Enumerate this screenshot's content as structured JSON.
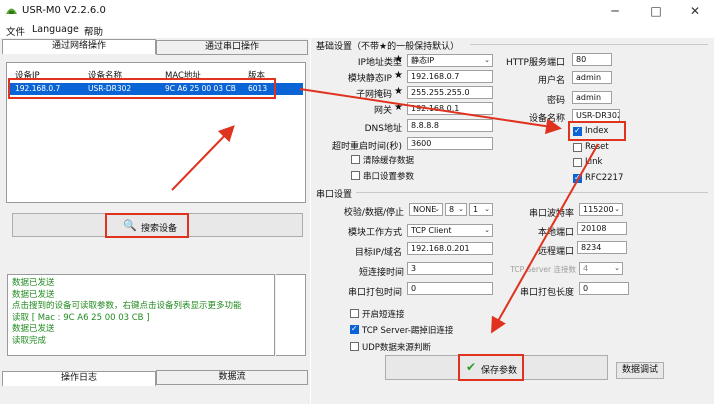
{
  "window": {
    "title": "USR-M0 V2.2.6.0"
  },
  "menu": [
    "文件",
    "Language",
    "帮助"
  ],
  "left_tabs": [
    "通过网络操作",
    "通过串口操作"
  ],
  "device_list": {
    "headers": [
      "设备IP",
      "设备名称",
      "MAC地址",
      "版本"
    ],
    "rows": [
      {
        "ip": "192.168.0.7",
        "name": "USR-DR302",
        "mac": "9C A6 25 00 03 CB",
        "version": "6013"
      }
    ]
  },
  "search_button": "搜索设备",
  "log": {
    "lines": [
      "数据已发送",
      "数据已发送",
      "点击搜到的设备可读取参数，右键点击设备列表显示更多功能",
      "读取 [ Mac : 9C A6 25 00 03 CB ]",
      "数据已发送",
      "读取完成"
    ],
    "tabs": [
      "操作日志",
      "数据流"
    ]
  },
  "basic": {
    "title": "基础设置（不带★的一般保持默认）",
    "ip_type_label": "IP地址类型",
    "ip_type_value": "静态IP",
    "static_ip_label": "模块静态IP",
    "static_ip_value": "192.168.0.7",
    "subnet_label": "子网掩码",
    "subnet_value": "255.255.255.0",
    "gateway_label": "网关",
    "gateway_value": "192.168.0.1",
    "dns_label": "DNS地址",
    "dns_value": "8.8.8.8",
    "timeout_label": "超时重启时间(秒)",
    "timeout_value": "3600",
    "clear_cache_label": "清除缓存数据",
    "serial_params_label": "串口设置参数",
    "http_port_label": "HTTP服务端口",
    "http_port_value": "80",
    "username_label": "用户名",
    "username_value": "admin",
    "password_label": "密码",
    "password_value": "admin",
    "device_name_label": "设备名称",
    "device_name_value": "USR-DR302",
    "index_label": "Index",
    "reset_label": "Reset",
    "link_label": "Link",
    "rfc_label": "RFC2217",
    "star": "★"
  },
  "serial": {
    "title": "串口设置",
    "check_label": "校验/数据/停止",
    "parity_value": "NONE",
    "databits_value": "8",
    "stopbits_value": "1",
    "baud_label": "串口波特率",
    "baud_value": "115200",
    "mode_label": "模块工作方式",
    "mode_value": "TCP Client",
    "local_port_label": "本地端口",
    "local_port_value": "20108",
    "target_label": "目标IP/域名",
    "target_value": "192.168.0.201",
    "remote_port_label": "远程端口",
    "remote_port_value": "8234",
    "short_conn_label": "短连接时间",
    "short_conn_value": "3",
    "tcp_server_conn_label": "TCP Server 连接数",
    "tcp_server_conn_value": "4",
    "pack_time_label": "串口打包时间",
    "pack_time_value": "0",
    "pack_len_label": "串口打包长度",
    "pack_len_value": "0",
    "open_short_label": "开启短连接",
    "kick_label": "TCP Server-踢掉旧连接",
    "udp_label": "UDP数据来源判断"
  },
  "save_button": "保存参数",
  "debug_button": "数据调试",
  "colors": {
    "annotation": "#e0331f",
    "selection": "#0a64d6",
    "log_text": "#1f8a1f"
  }
}
